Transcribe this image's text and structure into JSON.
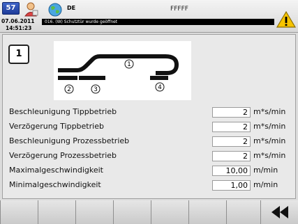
{
  "header": {
    "calendar_number": "57",
    "language": "DE",
    "title": "FFFFF",
    "date": "07.06.2011",
    "time": "14:51:23",
    "alarm_message": "016. (W) Schutztür wurde geöffnet"
  },
  "main": {
    "mode_number": "1",
    "diagram_labels": [
      "1",
      "2",
      "3",
      "4"
    ],
    "parameters": [
      {
        "label": "Beschleunigung Tippbetrieb",
        "value": "2",
        "unit": "m*s/min"
      },
      {
        "label": "Verzögerung Tippbetrieb",
        "value": "2",
        "unit": "m*s/min"
      },
      {
        "label": "Beschleunigung Prozessbetrieb",
        "value": "2",
        "unit": "m*s/min"
      },
      {
        "label": "Verzögerung Prozessbetrieb",
        "value": "2",
        "unit": "m*s/min"
      },
      {
        "label": "Maximalgeschwindigkeit",
        "value": "10,00",
        "unit": "m/min"
      },
      {
        "label": "Minimalgeschwindigkeit",
        "value": "1,00",
        "unit": "m/min"
      }
    ]
  },
  "footer": {
    "keys": [
      "f1",
      "f2",
      "f3",
      "f4",
      "f5",
      "f6",
      "f7",
      "back"
    ]
  },
  "icons": {
    "calendar": "calendar-icon",
    "user": "user-icon",
    "globe": "globe-icon",
    "warning": "warning-icon",
    "back": "back-icon"
  }
}
